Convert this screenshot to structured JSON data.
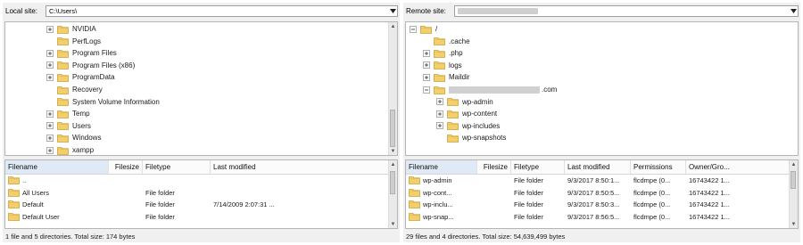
{
  "local": {
    "site_label": "Local site:",
    "site_path": "C:\\Users\\",
    "tree": [
      {
        "label": "NVIDIA",
        "expander": "plus"
      },
      {
        "label": "PerfLogs",
        "expander": "none"
      },
      {
        "label": "Program Files",
        "expander": "plus"
      },
      {
        "label": "Program Files (x86)",
        "expander": "plus"
      },
      {
        "label": "ProgramData",
        "expander": "plus"
      },
      {
        "label": "Recovery",
        "expander": "none"
      },
      {
        "label": "System Volume Information",
        "expander": "none"
      },
      {
        "label": "Temp",
        "expander": "plus"
      },
      {
        "label": "Users",
        "expander": "plus"
      },
      {
        "label": "Windows",
        "expander": "plus"
      },
      {
        "label": "xampp",
        "expander": "plus"
      }
    ],
    "columns": [
      "Filename",
      "Filesize",
      "Filetype",
      "Last modified"
    ],
    "files": [
      {
        "name": "..",
        "size": "",
        "type": "",
        "modified": ""
      },
      {
        "name": "All Users",
        "size": "",
        "type": "File folder",
        "modified": ""
      },
      {
        "name": "Default",
        "size": "",
        "type": "File folder",
        "modified": "7/14/2009 2:07:31 ..."
      },
      {
        "name": "Default User",
        "size": "",
        "type": "File folder",
        "modified": ""
      }
    ],
    "status": "1 file and 5 directories. Total size: 174 bytes"
  },
  "remote": {
    "site_label": "Remote site:",
    "tree": [
      {
        "label": "/",
        "expander": "minus",
        "level": 0
      },
      {
        "label": ".cache",
        "expander": "none",
        "level": 1
      },
      {
        "label": ".php",
        "expander": "plus",
        "level": 1
      },
      {
        "label": "logs",
        "expander": "plus",
        "level": 1
      },
      {
        "label": "Maildir",
        "expander": "plus",
        "level": 1
      },
      {
        "label": ".com",
        "expander": "minus",
        "level": 1,
        "blurred_prefix": true
      },
      {
        "label": "wp-admin",
        "expander": "plus",
        "level": 2
      },
      {
        "label": "wp-content",
        "expander": "plus",
        "level": 2
      },
      {
        "label": "wp-includes",
        "expander": "plus",
        "level": 2
      },
      {
        "label": "wp-snapshots",
        "expander": "none",
        "level": 2
      }
    ],
    "columns": [
      "Filename",
      "Filesize",
      "Filetype",
      "Last modified",
      "Permissions",
      "Owner/Gro..."
    ],
    "files": [
      {
        "name": "wp-admin",
        "size": "",
        "type": "File folder",
        "modified": "9/3/2017 8:50:1...",
        "perms": "flcdmpe (0...",
        "owner": "16743422 1..."
      },
      {
        "name": "wp-cont...",
        "size": "",
        "type": "File folder",
        "modified": "9/3/2017 8:50:5...",
        "perms": "flcdmpe (0...",
        "owner": "16743422 1..."
      },
      {
        "name": "wp-inclu...",
        "size": "",
        "type": "File folder",
        "modified": "9/3/2017 8:50:3...",
        "perms": "flcdmpe (0...",
        "owner": "16743422 1..."
      },
      {
        "name": "wp-snap...",
        "size": "",
        "type": "File folder",
        "modified": "9/3/2017 8:56:5...",
        "perms": "flcdmpe (0...",
        "owner": "16743422 1..."
      }
    ],
    "status": "29 files and 4 directories. Total size: 54,639,499 bytes"
  },
  "icons": {
    "folder": "folder-icon",
    "expand": "plus-box-icon",
    "collapse": "minus-box-icon",
    "dropdown": "chevron-down-icon"
  },
  "colors": {
    "folder_fill": "#f2cf6b",
    "folder_stroke": "#c9a23c",
    "sort_header_bg": "#dfeaf6",
    "pane_bg": "#f0f0f0"
  }
}
